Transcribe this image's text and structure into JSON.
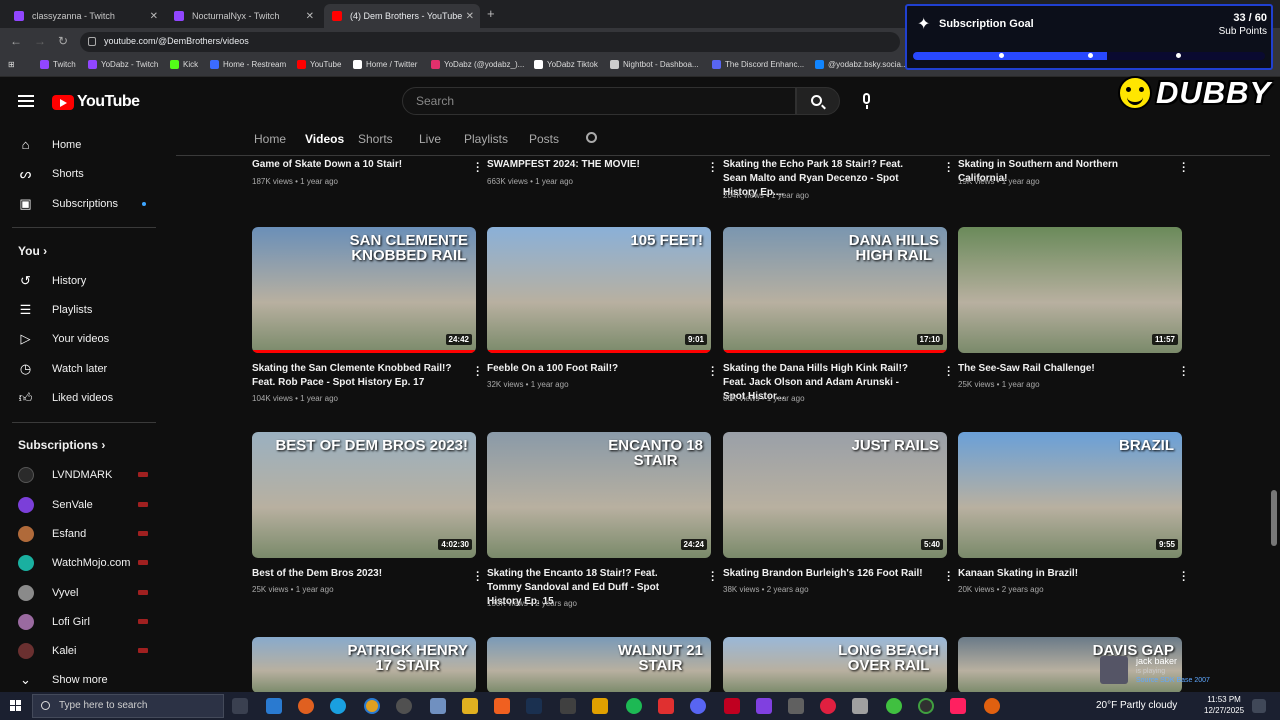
{
  "browser": {
    "tabs": [
      {
        "label": "classyzanna - Twitch",
        "color": "#9146ff"
      },
      {
        "label": "NocturnalNyx - Twitch",
        "color": "#9146ff"
      },
      {
        "label": "(4) Dem Brothers - YouTube",
        "color": "#ff0000"
      }
    ],
    "url": "youtube.com/@DemBrothers/videos",
    "bookmarks": [
      {
        "label": "Twitch",
        "color": "#9146ff"
      },
      {
        "label": "YoDabz - Twitch",
        "color": "#9146ff"
      },
      {
        "label": "Kick",
        "color": "#53fc18"
      },
      {
        "label": "Home - Restream",
        "color": "#3b6bff"
      },
      {
        "label": "YouTube",
        "color": "#ff0000"
      },
      {
        "label": "Home / Twitter",
        "color": "#ffffff"
      },
      {
        "label": "YoDabz (@yodabz_)...",
        "color": "#e1306c"
      },
      {
        "label": "YoDabz Tiktok",
        "color": "#ffffff"
      },
      {
        "label": "Nightbot - Dashboa...",
        "color": "#cccccc"
      },
      {
        "label": "The Discord Enhanc...",
        "color": "#5865f2"
      },
      {
        "label": "@yodabz.bsky.socia...",
        "color": "#1185fe"
      }
    ]
  },
  "youtube": {
    "logo_text": "YouTube",
    "search_placeholder": "Search",
    "sidebar": {
      "main": [
        {
          "label": "Home",
          "icon": "home-icon"
        },
        {
          "label": "Shorts",
          "icon": "shorts-icon"
        },
        {
          "label": "Subscriptions",
          "icon": "subscriptions-icon"
        }
      ],
      "you_heading": "You",
      "you": [
        {
          "label": "History",
          "icon": "history-icon"
        },
        {
          "label": "Playlists",
          "icon": "playlists-icon"
        },
        {
          "label": "Your videos",
          "icon": "your-videos-icon"
        },
        {
          "label": "Watch later",
          "icon": "watch-later-icon"
        },
        {
          "label": "Liked videos",
          "icon": "liked-videos-icon"
        }
      ],
      "subs_heading": "Subscriptions",
      "subscriptions": [
        {
          "label": "LVNDMARK",
          "color": "#2a2a2a"
        },
        {
          "label": "SenVale",
          "color": "#7b3fd9"
        },
        {
          "label": "Esfand",
          "color": "#b06a3a"
        },
        {
          "label": "WatchMojo.com",
          "color": "#1ab0a0"
        },
        {
          "label": "Vyvel",
          "color": "#8a8a8a"
        },
        {
          "label": "Lofi Girl",
          "color": "#9a6aa0"
        },
        {
          "label": "Kalei",
          "color": "#6a3030"
        }
      ],
      "show_more": "Show more"
    },
    "channel_tabs": [
      "Home",
      "Videos",
      "Shorts",
      "Live",
      "Playlists",
      "Posts"
    ],
    "active_tab": "Videos",
    "top_row": [
      {
        "title": "Game of Skate Down a 10 Stair!",
        "meta": "187K views • 1 year ago"
      },
      {
        "title": "SWAMPFEST 2024: THE MOVIE!",
        "meta": "663K views • 1 year ago"
      },
      {
        "title": "Skating the Echo Park 18 Stair!? Feat. Sean Malto and Ryan Decenzo - Spot History Ep....",
        "meta": "204K views • 1 year ago"
      },
      {
        "title": "Skating in Southern and Northern California!",
        "meta": "19K views • 1 year ago"
      }
    ],
    "videos": [
      {
        "thumb_text": "SAN CLEMENTE\nKNOBBED RAIL",
        "duration": "24:42",
        "title": "Skating the San Clemente Knobbed Rail!? Feat. Rob Pace - Spot History Ep. 17",
        "meta": "104K views • 1 year ago",
        "bg": "#6a8fb8",
        "watched": true
      },
      {
        "thumb_text": "105 FEET!",
        "duration": "9:01",
        "title": "Feeble On a 100 Foot Rail!?",
        "meta": "32K views • 1 year ago",
        "bg": "#8ab0d8",
        "watched": true
      },
      {
        "thumb_text": "DANA HILLS\nHIGH RAIL",
        "duration": "17:10",
        "title": "Skating the Dana Hills High Kink Rail!? Feat. Jack Olson and Adam Arunski - Spot Histor...",
        "meta": "80K views • 1 year ago",
        "bg": "#7a96b0",
        "watched": true
      },
      {
        "thumb_text": "",
        "duration": "11:57",
        "title": "The See-Saw Rail Challenge!",
        "meta": "25K views • 1 year ago",
        "bg": "#6a8a5a",
        "watched": false
      },
      {
        "thumb_text": "BEST OF DEM BROS 2023!",
        "duration": "4:02:30",
        "title": "Best of the Dem Bros 2023!",
        "meta": "25K views • 1 year ago",
        "bg": "#9ab0c0",
        "watched": false
      },
      {
        "thumb_text": "ENCANTO 18\nSTAIR",
        "duration": "24:24",
        "title": "Skating the Encanto 18 Stair!? Feat. Tommy Sandoval and Ed Duff - Spot History Ep. 15",
        "meta": "130K views • 2 years ago",
        "bg": "#8a9aa8",
        "watched": false
      },
      {
        "thumb_text": "JUST RAILS",
        "duration": "5:40",
        "title": "Skating Brandon Burleigh's 126 Foot Rail!",
        "meta": "38K views • 2 years ago",
        "bg": "#9aa0a8",
        "watched": false
      },
      {
        "thumb_text": "BRAZIL",
        "duration": "9:55",
        "title": "Kanaan Skating in Brazil!",
        "meta": "20K views • 2 years ago",
        "bg": "#6aa0d8",
        "watched": false
      },
      {
        "thumb_text": "PATRICK HENRY\n17 STAIR",
        "bg": "#88aacc"
      },
      {
        "thumb_text": "WALNUT 21\nSTAIR",
        "bg": "#7a9ab8"
      },
      {
        "thumb_text": "LONG BEACH\nOVER RAIL",
        "bg": "#9ab8d8"
      },
      {
        "thumb_text": "DAVIS GAP",
        "bg": "#6a7a88"
      }
    ]
  },
  "overlay": {
    "goal_title": "Subscription Goal",
    "goal_count": "33 / 60",
    "goal_unit": "Sub Points",
    "goal_progress": 0.55,
    "goal_color": "#2848ff",
    "brand": "DUBBY",
    "now_playing_name": "jack baker",
    "now_playing_status": "is playing",
    "now_playing_game": "Source SDK Base 2007"
  },
  "taskbar": {
    "search_placeholder": "Type here to search",
    "weather": "20°F  Partly cloudy",
    "time": "11:53 PM",
    "date": "12/27/2025"
  }
}
